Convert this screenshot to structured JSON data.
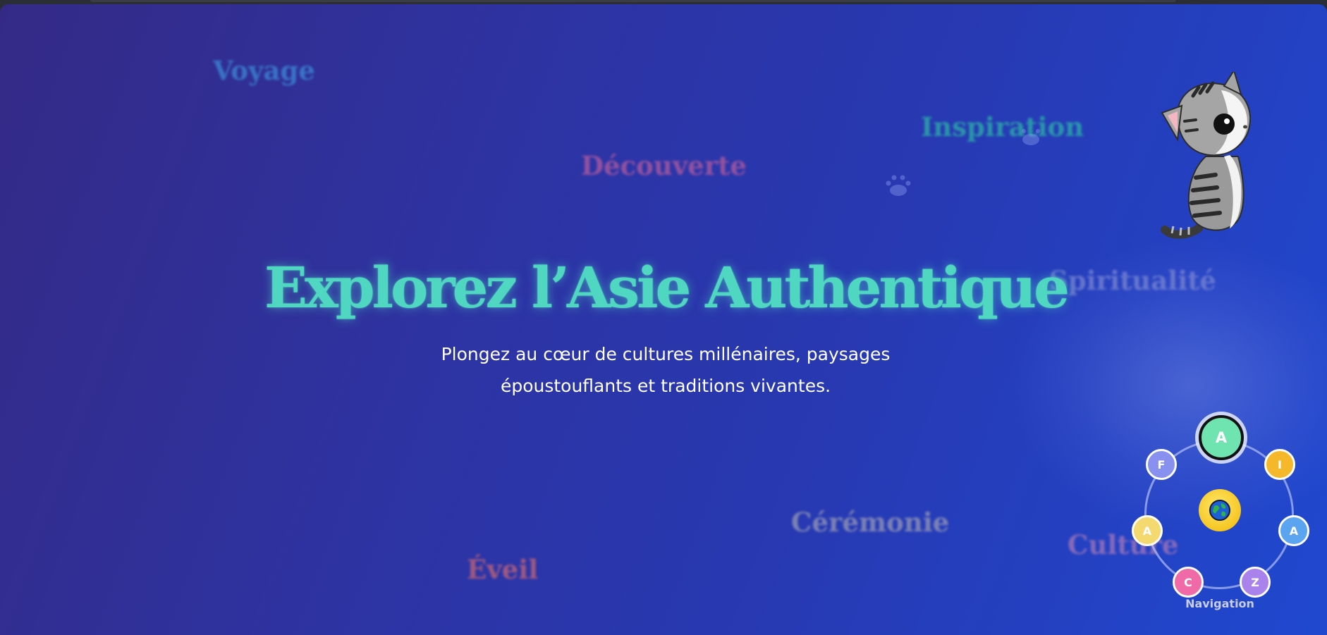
{
  "hero": {
    "title": "Explorez l’Asie Authentique",
    "subtitle": "Plongez au cœur de cultures millénaires, paysages époustouflants et traditions vivantes."
  },
  "floating_words": {
    "voyage": "Voyage",
    "inspiration": "Inspiration",
    "decouverte": "Découverte",
    "spiritualite": "Spiritualité",
    "ceremonie": "Cérémonie",
    "culture": "Culture",
    "eveil": "Éveil"
  },
  "mascot": {
    "icon": "cat-mascot-icon"
  },
  "nav": {
    "label": "Navigation",
    "center_icon": "globe-icon",
    "items": [
      {
        "letter": "A",
        "color": "#6fe3b0",
        "active": true
      },
      {
        "letter": "I",
        "color": "#f5b82a"
      },
      {
        "letter": "A",
        "color": "#5aa4f0"
      },
      {
        "letter": "Z",
        "color": "#a982ec"
      },
      {
        "letter": "C",
        "color": "#f06aa8"
      },
      {
        "letter": "A",
        "color": "#f4d870"
      },
      {
        "letter": "F",
        "color": "#8890f0"
      }
    ]
  }
}
